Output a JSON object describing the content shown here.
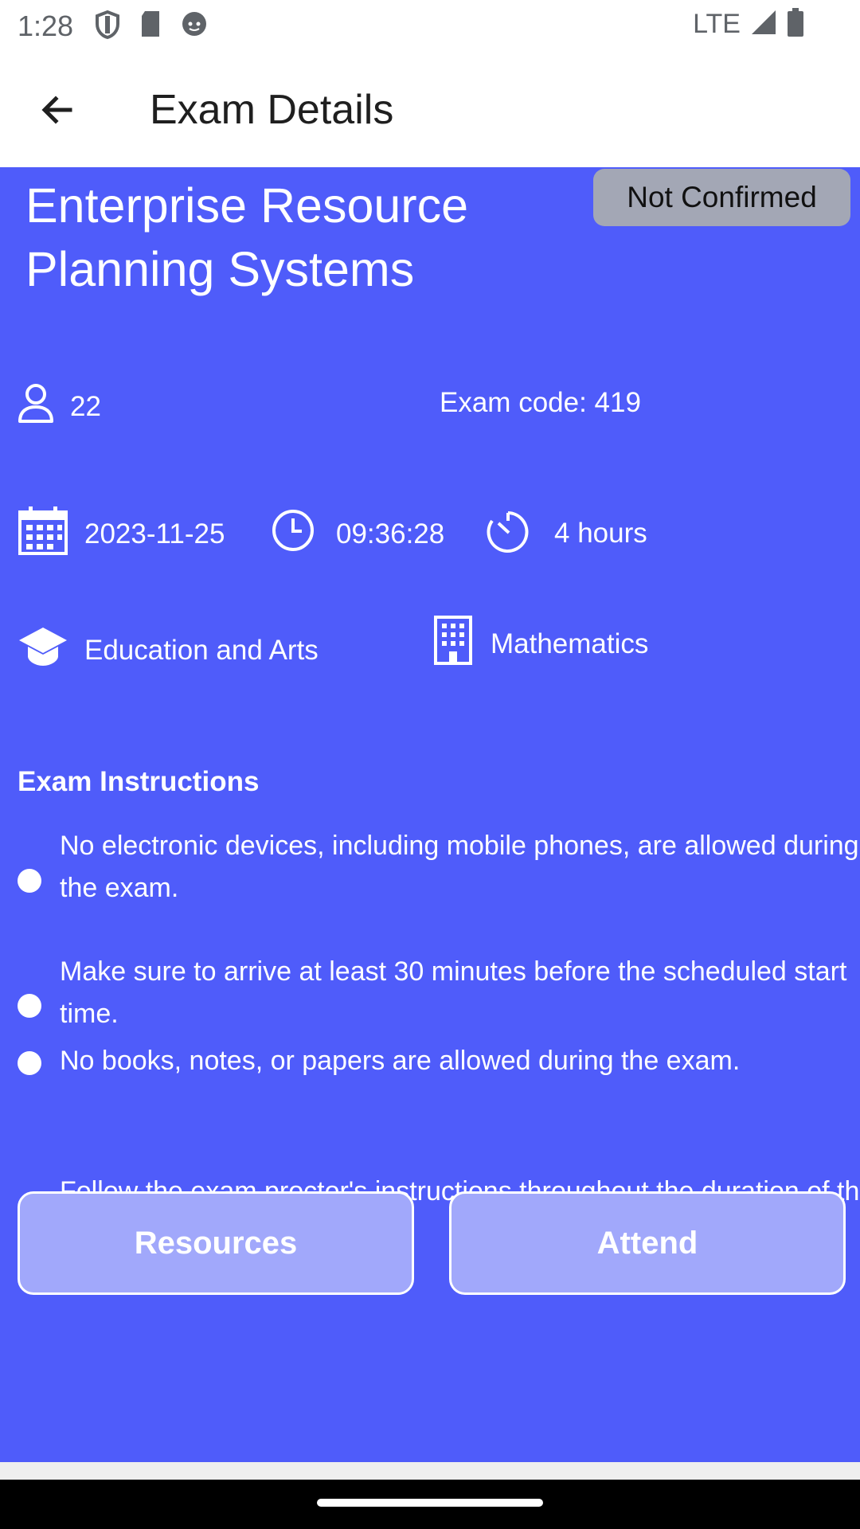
{
  "status_bar": {
    "time": "1:28",
    "network": "LTE"
  },
  "app_bar": {
    "title": "Exam Details"
  },
  "exam": {
    "title": "Enterprise Resource Planning Systems",
    "status": "Not Confirmed",
    "students": "22",
    "exam_code": "Exam code: 419",
    "date": "2023-11-25",
    "time": "09:36:28",
    "duration": "4 hours",
    "faculty": "Education and Arts",
    "department": "Mathematics"
  },
  "instructions": {
    "heading": "Exam Instructions",
    "items": [
      "No electronic devices, including mobile phones, are allowed during the exam.",
      "Make sure to arrive at least 30 minutes before the scheduled start time.",
      "No books, notes, or papers are allowed during the exam.",
      "Follow the exam proctor's instructions throughout the duration of the exam."
    ]
  },
  "actions": {
    "resources_label": "Resources",
    "attend_label": "Attend"
  },
  "colors": {
    "primary": "#4f5cfa",
    "badge": "#a3a7b5",
    "button": "#a1a8fb"
  }
}
